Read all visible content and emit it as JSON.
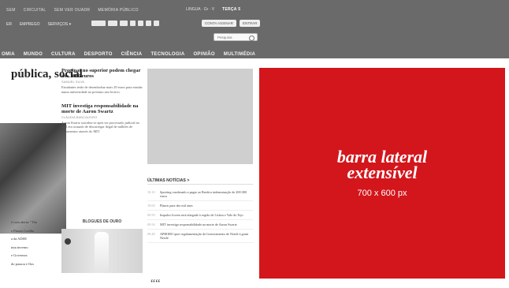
{
  "header": {
    "top_nav": [
      "SEM",
      "CIRCUITAL",
      "SEM VER OUADR",
      "MEMÓRIA PÚBLICO"
    ],
    "lang": "LINGUA · Gr · V",
    "date": "TERÇA 5",
    "row2_nav": [
      "ER",
      "EMPREGO",
      "SERVIÇOS ▾"
    ],
    "auth_buttons": [
      "CONTA ASSINAR",
      "ENTRAR"
    ],
    "search_placeholder": "Pesquisa",
    "sections": [
      "OMIA",
      "MUNDO",
      "CULTURA",
      "DESPORTO",
      "CIÊNCIA",
      "TECNOLOGIA",
      "OPINIÃO",
      "MULTIMÉDIA"
    ]
  },
  "content": {
    "lead_title": "pública, social",
    "articles": [
      {
        "headline": "Propinas no superior podem chegar aos 1066 euros",
        "meta": "SAMUEL SILVA",
        "body": "Estudantes terão de desembolsar mais 29 euros para estudar numa universidade no próximo ano lectivo."
      },
      {
        "headline": "MIT investiga responsabilidade na morte de Aaron Swartz",
        "meta": "CLÁUDIA BANCALEIRO",
        "body": "Aaron Swartz suicidou-se após ser processado judicial no qual era acusado de descarregar ilegal de milhões de documentos através do MIT."
      }
    ],
    "left_list": [
      "é com alerta: \"Tão",
      "e Passos Coelho",
      "a da ADSE",
      "inta inverno",
      "e Governos",
      "do passou e Ilos"
    ],
    "blogs_title": "BLOGUES DE OURO",
    "last_news_title": "ÚLTIMAS NOTÍCIAS >",
    "last_news": [
      {
        "time": "10:10",
        "text": "Sporting condenado a pagar ao Benfica indemnização de 200 000 euros"
      },
      {
        "time": "10:00",
        "text": "Planos para dez mil anos"
      },
      {
        "time": "09:59",
        "text": "Impulso Jovem será alargado à região de Lisboa e Vale do Tejo"
      },
      {
        "time": "09:54",
        "text": "MIT investiga responsabilidade na morte de Aaron Swartz"
      },
      {
        "time": "09:48",
        "text": "APROBO quer regulamentação do licenciamento de Nestlé à grant Nestlé"
      }
    ],
    "quote_mark": "““"
  },
  "ad": {
    "title_line1": "barra lateral",
    "title_line2": "extensível",
    "size": "700 x 600 px",
    "color": "#d3161c"
  }
}
